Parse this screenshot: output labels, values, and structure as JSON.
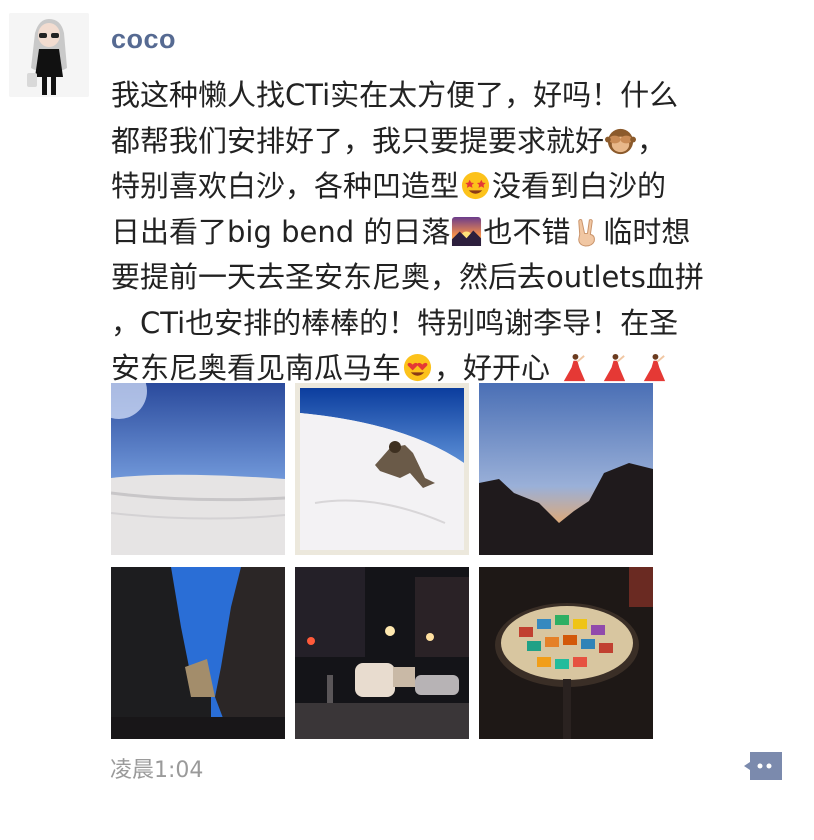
{
  "post": {
    "username": "coco",
    "text_lines": [
      [
        "我这种懒人找CTi实在太方便了，好吗！什么"
      ],
      [
        "都帮我们安排好了，我只要提要求就好",
        "，"
      ],
      [
        "特别喜欢白沙，各种凹造型",
        "没看到白沙的"
      ],
      [
        "日出看了big bend 的日落",
        "也不错",
        "临时想"
      ],
      [
        "要提前一天去圣安东尼奥，然后去outlets血拼"
      ],
      [
        "，CTi也安排的棒棒的！特别鸣谢李导！在圣"
      ],
      [
        "安东尼奥看见南瓜马车",
        "，好开心"
      ]
    ],
    "emoji_names": [
      "see-no-evil-monkey-icon",
      "star-struck-face-icon",
      "sunset-icon",
      "victory-hand-icon",
      "heart-eyes-face-icon",
      "dancer-icon"
    ],
    "photos": [
      {
        "name": "white-sand-dunes-photo"
      },
      {
        "name": "person-on-dune-photo"
      },
      {
        "name": "big-bend-sunset-photo"
      },
      {
        "name": "canyon-photo"
      },
      {
        "name": "night-street-carriage-photo"
      },
      {
        "name": "mosaic-table-photo"
      }
    ],
    "timestamp": "凌晨1:04"
  }
}
